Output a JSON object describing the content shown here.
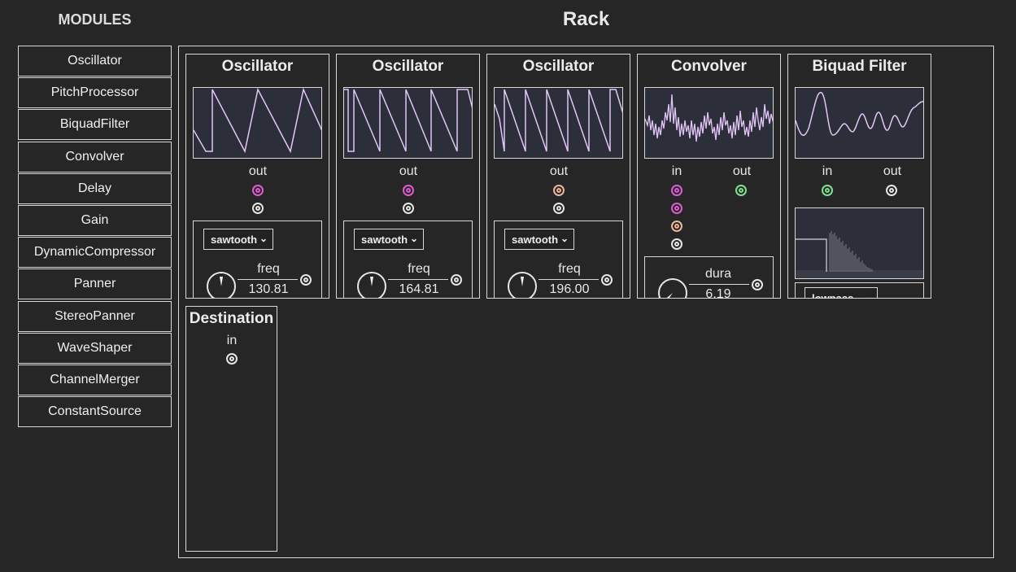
{
  "sidebar": {
    "title": "MODULES",
    "items": [
      {
        "label": "Oscillator"
      },
      {
        "label": "PitchProcessor"
      },
      {
        "label": "BiquadFilter"
      },
      {
        "label": "Convolver"
      },
      {
        "label": "Delay"
      },
      {
        "label": "Gain"
      },
      {
        "label": "DynamicCompressor"
      },
      {
        "label": "Panner"
      },
      {
        "label": "StereoPanner"
      },
      {
        "label": "WaveShaper"
      },
      {
        "label": "ChannelMerger"
      },
      {
        "label": "ConstantSource"
      }
    ]
  },
  "rack": {
    "title": "Rack",
    "modules": [
      {
        "title": "Oscillator",
        "out_label": "out",
        "waveform": "sawtooth",
        "param_name": "freq",
        "param_value": "130.81",
        "out_color": "magenta"
      },
      {
        "title": "Oscillator",
        "out_label": "out",
        "waveform": "sawtooth",
        "param_name": "freq",
        "param_value": "164.81",
        "out_color": "magenta"
      },
      {
        "title": "Oscillator",
        "out_label": "out",
        "waveform": "sawtooth",
        "param_name": "freq",
        "param_value": "196.00",
        "out_color": "peach"
      },
      {
        "title": "Convolver",
        "in_label": "in",
        "out_label": "out",
        "param_name": "dura",
        "param_value": "6.19"
      },
      {
        "title": "Biquad Filter",
        "in_label": "in",
        "out_label": "out",
        "filter_type": "lowpass"
      }
    ],
    "destination": {
      "title": "Destination",
      "in_label": "in"
    }
  },
  "colors": {
    "background": "#262626",
    "border": "#d8d8d8",
    "scope_bg": "#2c2f3a",
    "wave": "#e2c6f6",
    "jack_magenta": "#e05bd0",
    "jack_peach": "#f0b49a",
    "jack_green": "#7fe08f"
  }
}
